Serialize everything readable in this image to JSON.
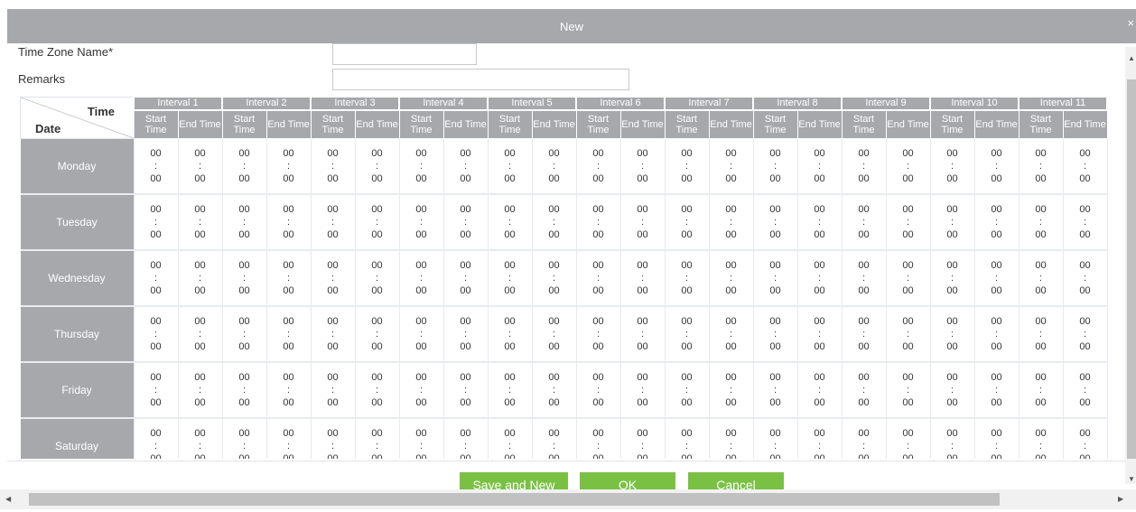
{
  "dialog": {
    "title": "New"
  },
  "form": {
    "time_zone_label": "Time Zone Name*",
    "time_zone_value": "",
    "remarks_label": "Remarks",
    "remarks_value": ""
  },
  "grid": {
    "corner_time": "Time",
    "corner_date": "Date",
    "intervals": [
      "Interval 1",
      "Interval 2",
      "Interval 3",
      "Interval 4",
      "Interval 5",
      "Interval 6",
      "Interval 7",
      "Interval 8",
      "Interval 9",
      "Interval 10",
      "Interval 11"
    ],
    "start_label": "Start Time",
    "end_label": "End Time",
    "days": [
      "Monday",
      "Tuesday",
      "Wednesday",
      "Thursday",
      "Friday",
      "Saturday"
    ],
    "hour": "00",
    "separator": ":",
    "minute": "00"
  },
  "buttons": {
    "save_and_new": "Save and New",
    "ok": "OK",
    "cancel": "Cancel"
  },
  "icons": {
    "close": "close-icon",
    "scroll_up": "scroll-up-icon",
    "scroll_down": "scroll-down-icon",
    "scroll_left": "scroll-left-icon",
    "scroll_right": "scroll-right-icon"
  },
  "colors": {
    "header_gray": "#a6a8ab",
    "button_green": "#7ac143"
  }
}
